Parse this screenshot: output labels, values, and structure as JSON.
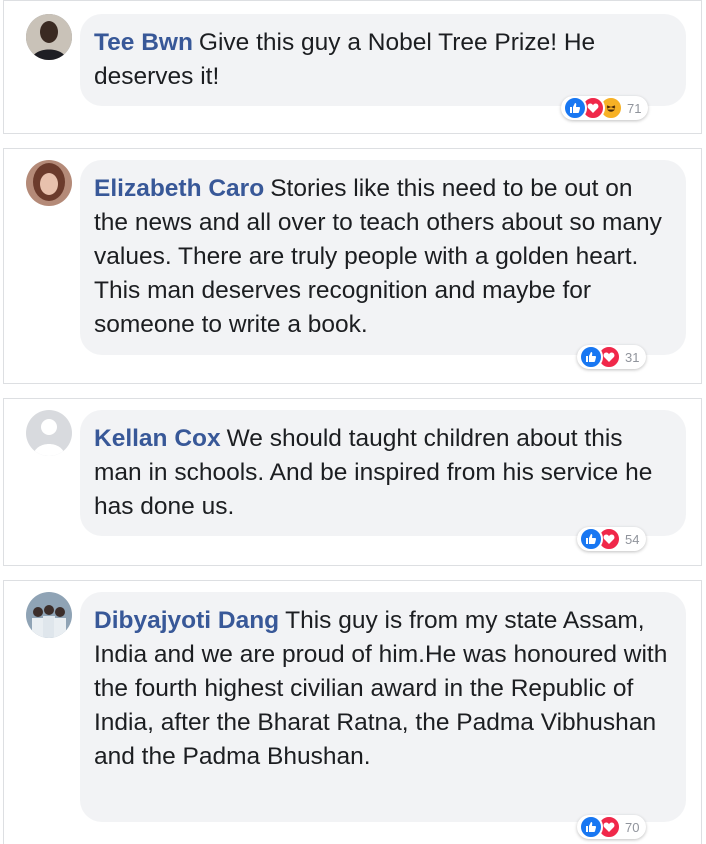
{
  "comments": [
    {
      "author": "Tee Bwn",
      "text": "Give this guy a Nobel Tree Prize! He deserves it!",
      "reactions": [
        "like-icon",
        "love-icon",
        "haha-icon"
      ],
      "reaction_count": "71"
    },
    {
      "author": "Elizabeth Caro",
      "text": "Stories like this need to be out on the news and all over to teach others about so many values. There are truly people with a golden heart. This man deserves recognition and maybe for someone to write a book.",
      "reactions": [
        "like-icon",
        "love-icon"
      ],
      "reaction_count": "31"
    },
    {
      "author": "Kellan Cox",
      "text": "We should taught children about this man in schools. And be inspired from his service he has done us.",
      "reactions": [
        "like-icon",
        "love-icon"
      ],
      "reaction_count": "54"
    },
    {
      "author": "Dibyajyoti Dang",
      "text": "This guy is from my state Assam, India and we are proud of him.He was honoured with the fourth highest civilian award in the Republic of India, after the Bharat Ratna, the Padma Vibhushan and the Padma Bhushan.",
      "reactions": [
        "like-icon",
        "love-icon"
      ],
      "reaction_count": "70"
    }
  ],
  "colors": {
    "name": "#385898",
    "bubble": "#f2f3f5",
    "like": "#1877f2",
    "love": "#f0284a",
    "haha": "#f7b125"
  }
}
